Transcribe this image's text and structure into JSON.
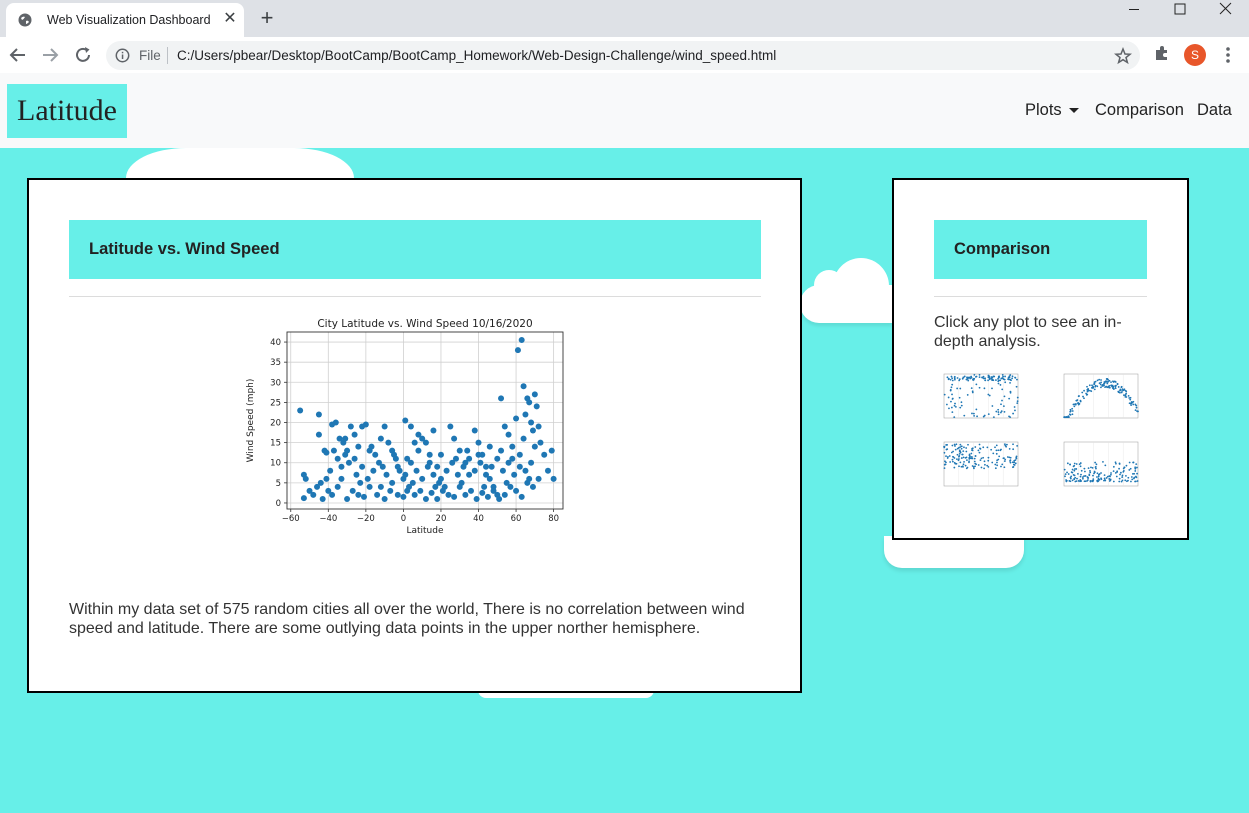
{
  "browser": {
    "tab_title": "Web Visualization Dashboard",
    "file_label": "File",
    "url": "C:/Users/pbear/Desktop/BootCamp/BootCamp_Homework/Web-Design-Challenge/wind_speed.html",
    "avatar_letter": "S"
  },
  "nav": {
    "brand": "Latitude",
    "links": [
      "Plots",
      "Comparison",
      "Data"
    ]
  },
  "main_card": {
    "header": "Latitude vs. Wind Speed",
    "description": "Within my data set of 575 random cities all over the world, There is no correlation between wind speed and latitude. There are some outlying data points in the upper norther hemisphere."
  },
  "comparison_card": {
    "header": "Comparison",
    "text": "Click any plot to see an in-depth analysis."
  },
  "colors": {
    "background": "#67efe8",
    "accent": "#67efe8",
    "point": "#1f77b4"
  },
  "chart_data": {
    "type": "scatter",
    "title": "City Latitude vs. Wind Speed 10/16/2020",
    "xlabel": "Latitude",
    "ylabel": "Wind Speed (mph)",
    "xlim": [
      -62,
      85
    ],
    "ylim": [
      -1.5,
      42.5
    ],
    "xticks": [
      -60,
      -40,
      -20,
      0,
      20,
      40,
      60,
      80
    ],
    "xtick_labels": [
      "−60",
      "−40",
      "−20",
      "0",
      "20",
      "40",
      "60",
      "80"
    ],
    "yticks": [
      0,
      5,
      10,
      15,
      20,
      25,
      30,
      35,
      40
    ],
    "grid": true,
    "points": [
      [
        -55,
        23
      ],
      [
        -53,
        7
      ],
      [
        -52,
        6
      ],
      [
        -53,
        1.2
      ],
      [
        -45,
        22
      ],
      [
        -45,
        17
      ],
      [
        -42,
        13
      ],
      [
        -41,
        12.5
      ],
      [
        -46,
        4
      ],
      [
        -44,
        5
      ],
      [
        -40,
        3
      ],
      [
        -43,
        1
      ],
      [
        -38,
        19.5
      ],
      [
        -36,
        20
      ],
      [
        -34,
        16
      ],
      [
        -32,
        15
      ],
      [
        -31,
        16
      ],
      [
        -30,
        13
      ],
      [
        -35,
        11
      ],
      [
        -33,
        9
      ],
      [
        -28,
        19
      ],
      [
        -26,
        17
      ],
      [
        -22,
        19
      ],
      [
        -20,
        19.5
      ],
      [
        -24,
        14
      ],
      [
        -18,
        13
      ],
      [
        -15,
        12
      ],
      [
        -12,
        16
      ],
      [
        -10,
        19
      ],
      [
        -8,
        15
      ],
      [
        -6,
        13
      ],
      [
        -4,
        11
      ],
      [
        -2,
        8
      ],
      [
        0,
        6
      ],
      [
        1,
        20.5
      ],
      [
        2,
        3
      ],
      [
        4,
        19
      ],
      [
        6,
        15
      ],
      [
        8,
        17
      ],
      [
        10,
        16
      ],
      [
        12,
        15
      ],
      [
        14,
        12
      ],
      [
        16,
        18
      ],
      [
        18,
        9
      ],
      [
        20,
        6
      ],
      [
        22,
        4
      ],
      [
        25,
        19
      ],
      [
        27,
        16
      ],
      [
        30,
        13
      ],
      [
        33,
        10
      ],
      [
        35,
        7
      ],
      [
        38,
        18
      ],
      [
        40,
        15
      ],
      [
        42,
        12
      ],
      [
        44,
        9
      ],
      [
        46,
        6
      ],
      [
        48,
        4
      ],
      [
        50,
        2
      ],
      [
        52,
        26
      ],
      [
        54,
        19
      ],
      [
        56,
        17
      ],
      [
        58,
        14
      ],
      [
        60,
        21
      ],
      [
        61,
        38
      ],
      [
        62,
        12
      ],
      [
        63,
        40.5
      ],
      [
        64,
        29
      ],
      [
        65,
        22
      ],
      [
        66,
        26
      ],
      [
        67,
        25
      ],
      [
        68,
        20
      ],
      [
        69,
        18
      ],
      [
        70,
        27
      ],
      [
        71,
        24
      ],
      [
        72,
        19
      ],
      [
        73,
        15
      ],
      [
        75,
        12
      ],
      [
        77,
        8
      ],
      [
        79,
        13
      ],
      [
        80,
        6
      ],
      [
        -50,
        3
      ],
      [
        -48,
        2
      ],
      [
        -38,
        2
      ],
      [
        -35,
        4
      ],
      [
        -30,
        1
      ],
      [
        -27,
        3
      ],
      [
        -24,
        2
      ],
      [
        -21,
        1.5
      ],
      [
        -18,
        4
      ],
      [
        -14,
        2
      ],
      [
        -10,
        1
      ],
      [
        -7,
        3
      ],
      [
        -3,
        2
      ],
      [
        0,
        1.5
      ],
      [
        3,
        4
      ],
      [
        6,
        2
      ],
      [
        9,
        3
      ],
      [
        12,
        1
      ],
      [
        15,
        2.5
      ],
      [
        18,
        1
      ],
      [
        21,
        3
      ],
      [
        24,
        2
      ],
      [
        27,
        1.5
      ],
      [
        30,
        4
      ],
      [
        33,
        2
      ],
      [
        36,
        3
      ],
      [
        39,
        1
      ],
      [
        42,
        2.5
      ],
      [
        45,
        1.5
      ],
      [
        48,
        3
      ],
      [
        51,
        1
      ],
      [
        54,
        2
      ],
      [
        57,
        4
      ],
      [
        60,
        3
      ],
      [
        63,
        1.5
      ],
      [
        66,
        5
      ],
      [
        69,
        4
      ],
      [
        72,
        6
      ],
      [
        -39,
        8
      ],
      [
        -33,
        6
      ],
      [
        -29,
        10
      ],
      [
        -25,
        7
      ],
      [
        -22,
        9
      ],
      [
        -19,
        6
      ],
      [
        -16,
        8
      ],
      [
        -13,
        10
      ],
      [
        -9,
        7
      ],
      [
        -6,
        5
      ],
      [
        -3,
        9
      ],
      [
        1,
        7
      ],
      [
        4,
        10
      ],
      [
        7,
        8
      ],
      [
        10,
        6
      ],
      [
        13,
        9
      ],
      [
        16,
        7
      ],
      [
        19,
        5
      ],
      [
        23,
        8
      ],
      [
        26,
        10
      ],
      [
        29,
        7
      ],
      [
        32,
        9
      ],
      [
        35,
        11
      ],
      [
        38,
        8
      ],
      [
        41,
        10
      ],
      [
        44,
        7
      ],
      [
        47,
        9
      ],
      [
        50,
        11
      ],
      [
        53,
        8
      ],
      [
        56,
        10
      ],
      [
        59,
        7
      ],
      [
        62,
        9
      ],
      [
        65,
        8
      ],
      [
        68,
        10
      ],
      [
        -37,
        13
      ],
      [
        -31,
        12
      ],
      [
        -26,
        11
      ],
      [
        -17,
        14
      ],
      [
        -11,
        9
      ],
      [
        -5,
        12
      ],
      [
        2,
        11
      ],
      [
        8,
        13
      ],
      [
        14,
        10
      ],
      [
        20,
        12
      ],
      [
        28,
        11
      ],
      [
        34,
        13
      ],
      [
        40,
        12
      ],
      [
        46,
        14
      ],
      [
        52,
        13
      ],
      [
        58,
        11
      ],
      [
        64,
        16
      ],
      [
        70,
        14
      ],
      [
        -41,
        6
      ],
      [
        -23,
        5
      ],
      [
        -12,
        4
      ],
      [
        5,
        5
      ],
      [
        17,
        4
      ],
      [
        31,
        5
      ],
      [
        43,
        4
      ],
      [
        55,
        5
      ],
      [
        67,
        6
      ]
    ]
  }
}
